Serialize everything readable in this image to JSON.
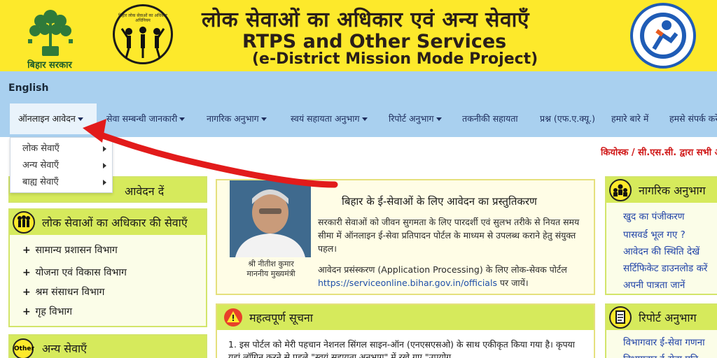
{
  "banner": {
    "gov_name": "बिहार सरकार",
    "rights_logo_text": "बिहार लोक सेवाओं का अधिकार अधिनियम",
    "title_hi": "लोक सेवाओं का अधिकार एवं अन्य सेवाएँ",
    "title_en": "RTPS and Other Services",
    "subtitle": "(e-District Mission Mode Project)",
    "colors": {
      "banner_bg": "#fde92b",
      "title": "#2a1f1a"
    }
  },
  "lang_link": "English",
  "nav": {
    "items": [
      {
        "label": "ऑनलाइन आवेदन",
        "has_caret": true,
        "active": true
      },
      {
        "label": "सेवा सम्बन्धी जानकारी",
        "has_caret": true
      },
      {
        "label": "नागरिक अनुभाग",
        "has_caret": true
      },
      {
        "label": "स्वयं सहायता अनुभाग",
        "has_caret": true
      },
      {
        "label": "रिपोर्ट अनुभाग",
        "has_caret": true
      },
      {
        "label": "तकनीकी सहायता",
        "has_caret": false
      },
      {
        "label": "प्रश्न (एफ.ए.क्यू.)",
        "has_caret": false
      },
      {
        "label": "हमारे बारे में",
        "has_caret": false
      },
      {
        "label": "हमसे संपर्क करें",
        "has_caret": false
      }
    ]
  },
  "dropdown": {
    "items": [
      {
        "label": "लोक सेवाएँ"
      },
      {
        "label": "अन्य सेवाएँ"
      },
      {
        "label": "बाह्य सेवाएँ"
      }
    ]
  },
  "ticker": "कियोस्क / सी.एस.सी. द्वारा सभी अ",
  "left": {
    "top_panel_title": "आवेदन दें",
    "rights_panel": {
      "title": "लोक सेवाओं का अधिकार की सेवाएँ",
      "departments": [
        "सामान्य प्रशासन विभाग",
        "योजना एवं विकास विभाग",
        "श्रम संसाधन विभाग",
        "गृह विभाग"
      ]
    },
    "other_panel": {
      "icon_text": "Other",
      "title": "अन्य सेवाएँ"
    }
  },
  "center": {
    "intro": {
      "cm_caption_1": "श्री नीतीश कुमार",
      "cm_caption_2": "माननीय मुख्यमंत्री",
      "title": "बिहार के ई-सेवाओं के लिए आवेदन का प्रस्तुतिकरण",
      "body": "सरकारी सेवाओं को जीवन सुगमता के लिए पारदर्शी एवं सुलभ तरीके से नियत समय सीमा में ऑनलाइन ई-सेवा प्रतिपादन पोर्टल के माध्यम से उपलब्ध कराने हेतु संयुक्त पहल।",
      "processing_text": "आवेदन प्रसंस्करण (Application Processing) के लिए लोक-सेवक पोर्टल",
      "link": "https://serviceonline.bihar.gov.in/officials",
      "link_suffix": " पर जायें।"
    },
    "notice": {
      "title": "महत्वपूर्ण सूचना",
      "body": "1. इस पोर्टल को मेरी पहचान नेशनल सिंगल साइन-ऑन (एनएसएसओ) के साथ एकीकृत किया गया है। कृपया यहां लॉगिन करने से पहले \"स्वयं सहायता अनुभाग\" में रखे गए \"उपयोग"
    }
  },
  "right": {
    "citizen_panel": {
      "title": "नागरिक अनुभाग",
      "links": [
        "खुद का पंजीकरण",
        "पासवर्ड भूल गए ?",
        "आवेदन की स्थिति देखें",
        "सर्टिफिकेट डाउनलोड करें",
        "अपनी पात्रता जानें"
      ]
    },
    "report_panel": {
      "title": "रिपोर्ट अनुभाग",
      "links": [
        "विभागवार ई-सेवा गणना",
        "विभागवार ई-सेवा प्रति"
      ]
    }
  }
}
